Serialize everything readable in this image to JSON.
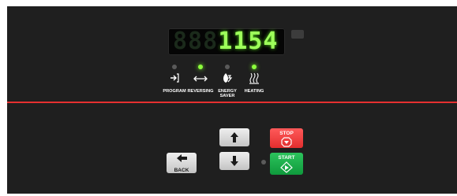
{
  "display": {
    "inactive_digits": "888",
    "value": "1154"
  },
  "indicators": [
    {
      "label": "PROGRAM",
      "active": false,
      "icon": "program-enter-icon"
    },
    {
      "label": "REVERSING",
      "active": true,
      "icon": "reversing-arrows-icon"
    },
    {
      "label": "ENERGY\nSAVER",
      "active": false,
      "icon": "energy-saver-icon"
    },
    {
      "label": "HEATING",
      "active": true,
      "icon": "heating-waves-icon"
    }
  ],
  "buttons": {
    "up_icon": "arrow-up-icon",
    "down_icon": "arrow-down-icon",
    "back": {
      "label": "BACK",
      "icon": "arrow-left-icon"
    },
    "stop": {
      "label": "STOP",
      "icon": "stop-octagon-icon"
    },
    "start": {
      "label": "START",
      "icon": "start-diamond-icon"
    }
  },
  "colors": {
    "panel": "#1f1f1f",
    "display_lit": "#9dff5a",
    "led_on": "#8cff3c",
    "divider": "#e53030",
    "stop": "#e22e2e",
    "start": "#0f9a3c"
  }
}
